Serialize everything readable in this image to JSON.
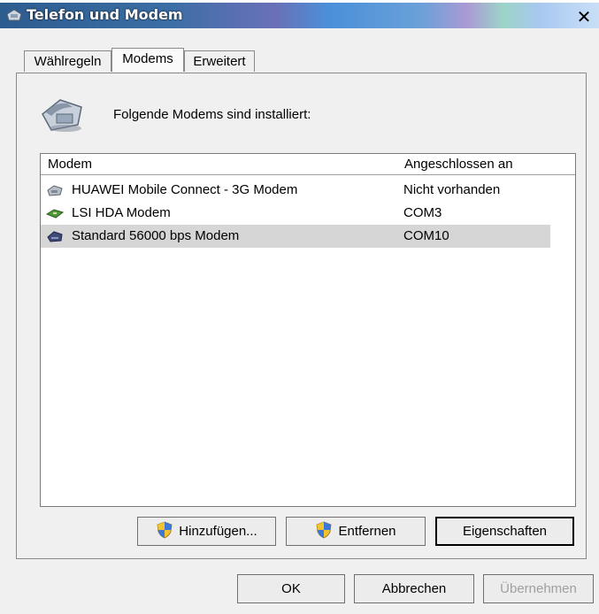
{
  "window": {
    "title": "Telefon und Modem",
    "close_glyph": "✕"
  },
  "tabs": [
    {
      "label": "Wählregeln",
      "active": false
    },
    {
      "label": "Modems",
      "active": true
    },
    {
      "label": "Erweitert",
      "active": false
    }
  ],
  "intro_text": "Folgende Modems sind installiert:",
  "modem_list": {
    "columns": [
      "Modem",
      "Angeschlossen an"
    ],
    "rows": [
      {
        "name": "HUAWEI Mobile Connect - 3G Modem",
        "port": "Nicht vorhanden",
        "icon": "modem-gray-icon",
        "selected": false
      },
      {
        "name": "LSI HDA Modem",
        "port": "COM3",
        "icon": "modem-card-icon",
        "selected": false
      },
      {
        "name": "Standard 56000 bps Modem",
        "port": "COM10",
        "icon": "modem-external-icon",
        "selected": true
      }
    ]
  },
  "buttons": {
    "add": "Hinzufügen...",
    "remove": "Entfernen",
    "properties": "Eigenschaften",
    "ok": "OK",
    "cancel": "Abbrechen",
    "apply": "Übernehmen"
  }
}
